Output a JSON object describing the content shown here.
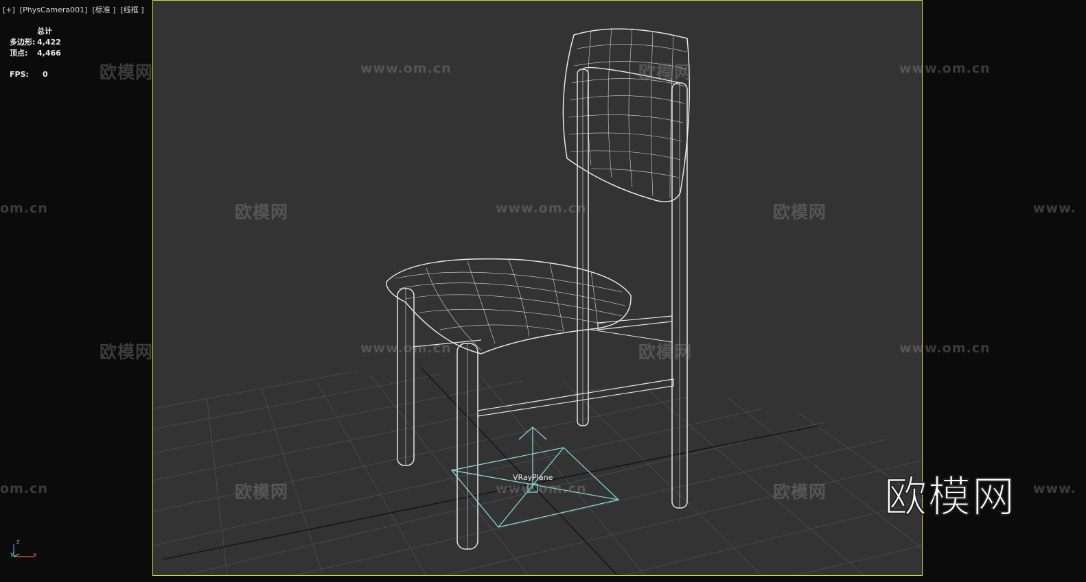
{
  "viewport": {
    "header": "[+]  [PhysCamera001]  [标准 ]  [线框 ]",
    "stats": {
      "total_label": "总计",
      "polygons_label": "多边形:",
      "polygons_value": "4,422",
      "vertices_label": "顶点:",
      "vertices_value": "4,466",
      "fps_label": "FPS:",
      "fps_value": "0"
    },
    "active_border_color": "#d6d63a",
    "background_color": "#333333",
    "object_label": "VRayPlane",
    "axis_labels": {
      "x": "x",
      "y": "y",
      "z": "z"
    }
  },
  "watermarks": {
    "logo_text": "欧模网",
    "url_text": "www.om.cn",
    "partial_url": "om.cn",
    "partial_url_right": "www.",
    "big_logo": "欧模网"
  },
  "icons": [
    "axis-tripod-icon",
    "vrayplane-gizmo-icon"
  ]
}
